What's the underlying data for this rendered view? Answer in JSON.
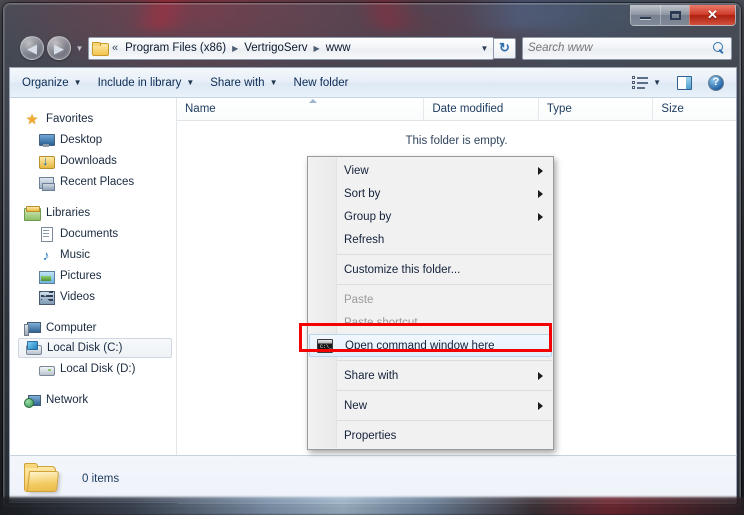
{
  "window": {
    "buttons": {
      "minimize": "minimize",
      "maximize": "maximize",
      "close": "✕"
    }
  },
  "address": {
    "back_glyph": "◀",
    "forward_glyph": "▶",
    "history_glyph": "▼",
    "overflow_glyph": "«",
    "crumbs": [
      "Program Files (x86)",
      "VertrigoServ",
      "www"
    ],
    "separator": "▶",
    "dropdown_glyph": "▼",
    "refresh_glyph": "↻"
  },
  "search": {
    "placeholder": "Search www",
    "value": ""
  },
  "commandbar": {
    "organize": "Organize",
    "include_in_library": "Include in library",
    "share_with": "Share with",
    "new_folder": "New folder",
    "caret": "▼",
    "help_glyph": "?"
  },
  "navpane": {
    "groups": [
      {
        "header": {
          "label": "Favorites",
          "icon": "star-icon"
        },
        "items": [
          {
            "label": "Desktop",
            "icon": "desktop-icon"
          },
          {
            "label": "Downloads",
            "icon": "downloads-icon"
          },
          {
            "label": "Recent Places",
            "icon": "recent-places-icon"
          }
        ]
      },
      {
        "header": {
          "label": "Libraries",
          "icon": "libraries-icon"
        },
        "items": [
          {
            "label": "Documents",
            "icon": "documents-icon"
          },
          {
            "label": "Music",
            "icon": "music-icon"
          },
          {
            "label": "Pictures",
            "icon": "pictures-icon"
          },
          {
            "label": "Videos",
            "icon": "videos-icon"
          }
        ]
      },
      {
        "header": {
          "label": "Computer",
          "icon": "computer-icon"
        },
        "items": [
          {
            "label": "Local Disk (C:)",
            "icon": "local-disk-c-icon",
            "selected": true
          },
          {
            "label": "Local Disk (D:)",
            "icon": "local-disk-d-icon"
          }
        ]
      },
      {
        "header": {
          "label": "Network",
          "icon": "network-icon"
        },
        "items": []
      }
    ]
  },
  "filelist": {
    "columns": [
      {
        "label": "Name"
      },
      {
        "label": "Date modified"
      },
      {
        "label": "Type"
      },
      {
        "label": "Size"
      }
    ],
    "empty_message": "This folder is empty.",
    "rows": []
  },
  "scrollbar": {
    "left_glyph": "◀",
    "right_glyph": "▶",
    "grip": "|||"
  },
  "status": {
    "item_count": "0 items"
  },
  "context_menu": {
    "items": [
      {
        "label": "View",
        "submenu": true
      },
      {
        "label": "Sort by",
        "submenu": true
      },
      {
        "label": "Group by",
        "submenu": true
      },
      {
        "label": "Refresh",
        "submenu": false
      },
      {
        "separator": true
      },
      {
        "label": "Customize this folder...",
        "submenu": false
      },
      {
        "separator": true
      },
      {
        "label": "Paste",
        "submenu": false,
        "disabled": true
      },
      {
        "label": "Paste shortcut",
        "submenu": false,
        "disabled": true
      },
      {
        "label": "Open command window here",
        "submenu": false,
        "highlighted": true,
        "icon": "command-prompt-icon"
      },
      {
        "separator": true
      },
      {
        "label": "Share with",
        "submenu": true
      },
      {
        "separator": true
      },
      {
        "label": "New",
        "submenu": true
      },
      {
        "separator": true
      },
      {
        "label": "Properties",
        "submenu": false
      }
    ],
    "command_icon_text": "C:\\_"
  },
  "annotation": {
    "highlight_color": "#f40000",
    "target": "Open command window here"
  }
}
